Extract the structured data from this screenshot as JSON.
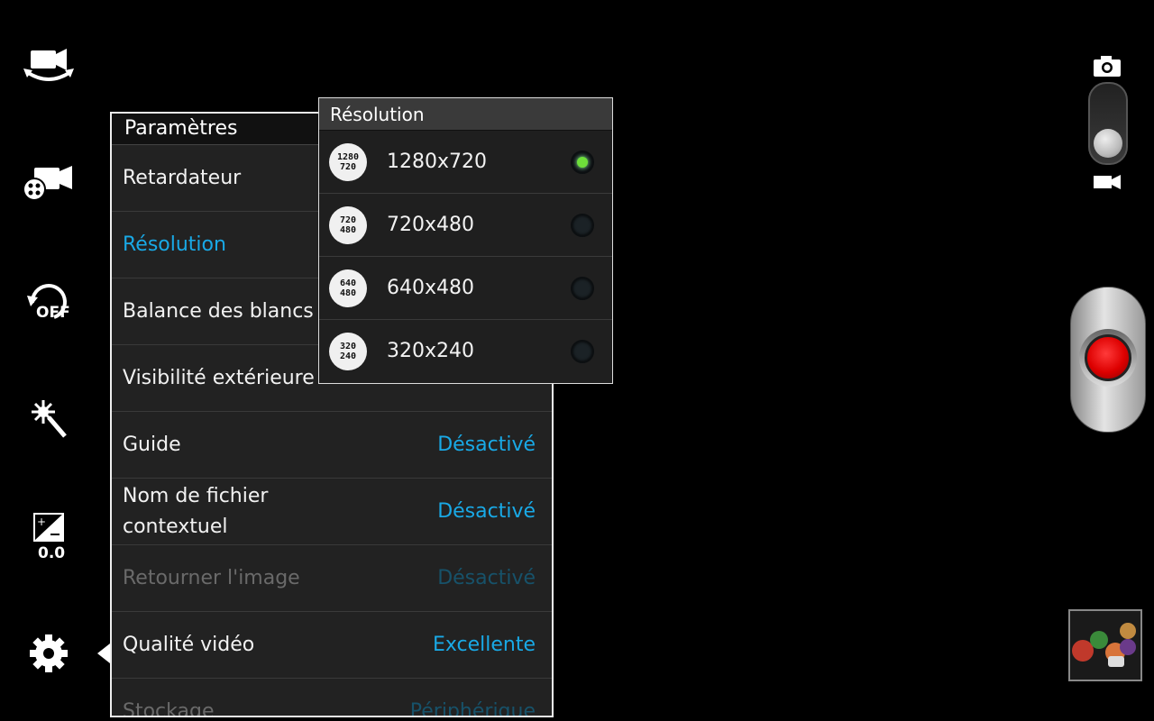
{
  "left_toolbar": {
    "exposure_value": "0.0",
    "timer_text": "OFF",
    "icons": [
      "switch-camera-icon",
      "video-effects-icon",
      "timer-off-icon",
      "scene-effects-icon",
      "exposure-icon",
      "settings-gear-icon"
    ]
  },
  "settings": {
    "title": "Paramètres",
    "rows": [
      {
        "label": "Retardateur",
        "value": ""
      },
      {
        "label": "Résolution",
        "value": ""
      },
      {
        "label": "Balance des blancs",
        "value": ""
      },
      {
        "label": "Visibilité extérieure",
        "value": ""
      },
      {
        "label": "Guide",
        "value": "Désactivé"
      },
      {
        "label": "Nom de fichier\ncontextuel",
        "value": "Désactivé"
      },
      {
        "label": "Retourner l'image",
        "value": "Désactivé"
      },
      {
        "label": "Qualité vidéo",
        "value": "Excellente"
      },
      {
        "label": "Stockage",
        "value": "Périphérique"
      }
    ]
  },
  "resolution_popup": {
    "title": "Résolution",
    "options": [
      {
        "label": "1280x720",
        "icon_top": "1280",
        "icon_bottom": "720",
        "selected": true
      },
      {
        "label": "720x480",
        "icon_top": "720",
        "icon_bottom": "480",
        "selected": false
      },
      {
        "label": "640x480",
        "icon_top": "640",
        "icon_bottom": "480",
        "selected": false
      },
      {
        "label": "320x240",
        "icon_top": "320",
        "icon_bottom": "240",
        "selected": false
      }
    ]
  },
  "right_controls": {
    "mode_icons": [
      "camera-icon",
      "video-camera-icon"
    ],
    "selected_mode": "video",
    "record_color": "#d00000"
  },
  "colors": {
    "accent": "#19a9e6",
    "radio_selected": "#6ee03a"
  }
}
